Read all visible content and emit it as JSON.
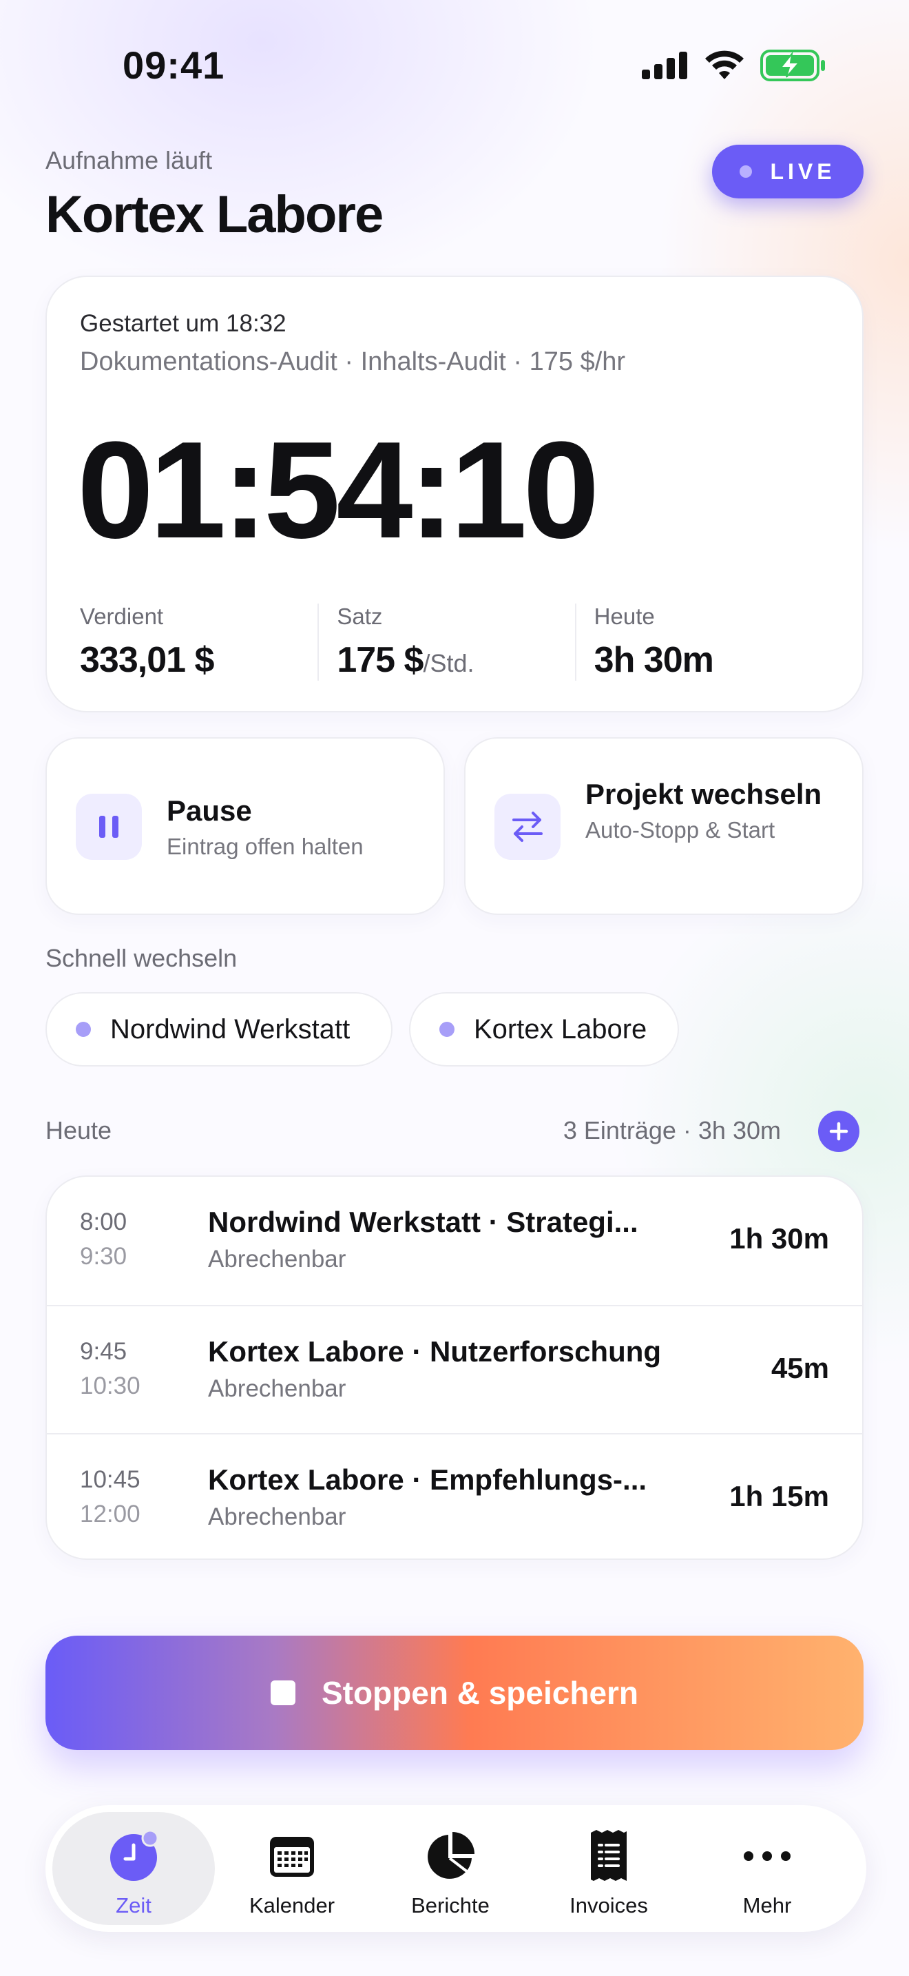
{
  "status_bar": {
    "time": "09:41"
  },
  "header": {
    "subtitle": "Aufnahme läuft",
    "title": "Kortex Labore",
    "live_badge": "LIVE"
  },
  "timer_card": {
    "started": "Gestartet um 18:32",
    "meta": "Dokumentations-Audit · Inhalts-Audit · 175 $/hr",
    "elapsed": "01:54:10",
    "stats": [
      {
        "label": "Verdient",
        "value": "333,01 $",
        "unit": ""
      },
      {
        "label": "Satz",
        "value": "175 $",
        "unit": "/Std."
      },
      {
        "label": "Heute",
        "value": "3h 30m",
        "unit": ""
      }
    ]
  },
  "actions": {
    "pause": {
      "title": "Pause",
      "desc": "Eintrag offen halten",
      "icon": "pause-icon"
    },
    "switch": {
      "title": "Projekt wechseln",
      "desc": "Auto-Stopp & Start",
      "icon": "swap-arrows-icon"
    }
  },
  "quick_switch": {
    "label": "Schnell wechseln",
    "chips": [
      "Nordwind Werkstatt",
      "Kortex Labore"
    ]
  },
  "today": {
    "label": "Heute",
    "summary": "3 Einträge · 3h 30m",
    "entries": [
      {
        "start": "8:00",
        "end": "9:30",
        "title": "Nordwind Werkstatt · Strategi...",
        "sub": "Abrechenbar",
        "duration": "1h 30m"
      },
      {
        "start": "9:45",
        "end": "10:30",
        "title": "Kortex Labore · Nutzerforschung",
        "sub": "Abrechenbar",
        "duration": "45m"
      },
      {
        "start": "10:45",
        "end": "12:00",
        "title": "Kortex Labore · Empfehlungs-...",
        "sub": "Abrechenbar",
        "duration": "1h 15m"
      }
    ]
  },
  "stop_button": {
    "label": "Stoppen & speichern"
  },
  "tabs": [
    {
      "label": "Zeit",
      "icon": "clock-icon",
      "active": true
    },
    {
      "label": "Kalender",
      "icon": "calendar-icon",
      "active": false
    },
    {
      "label": "Berichte",
      "icon": "pie-chart-icon",
      "active": false
    },
    {
      "label": "Invoices",
      "icon": "receipt-icon",
      "active": false
    },
    {
      "label": "Mehr",
      "icon": "more-icon",
      "active": false
    }
  ],
  "colors": {
    "accent": "#6b5cf6",
    "accent_soft": "#efedff",
    "battery": "#34c759",
    "stop_gradient": [
      "#6a5cf7",
      "#ff7b52",
      "#ffb26e"
    ]
  }
}
